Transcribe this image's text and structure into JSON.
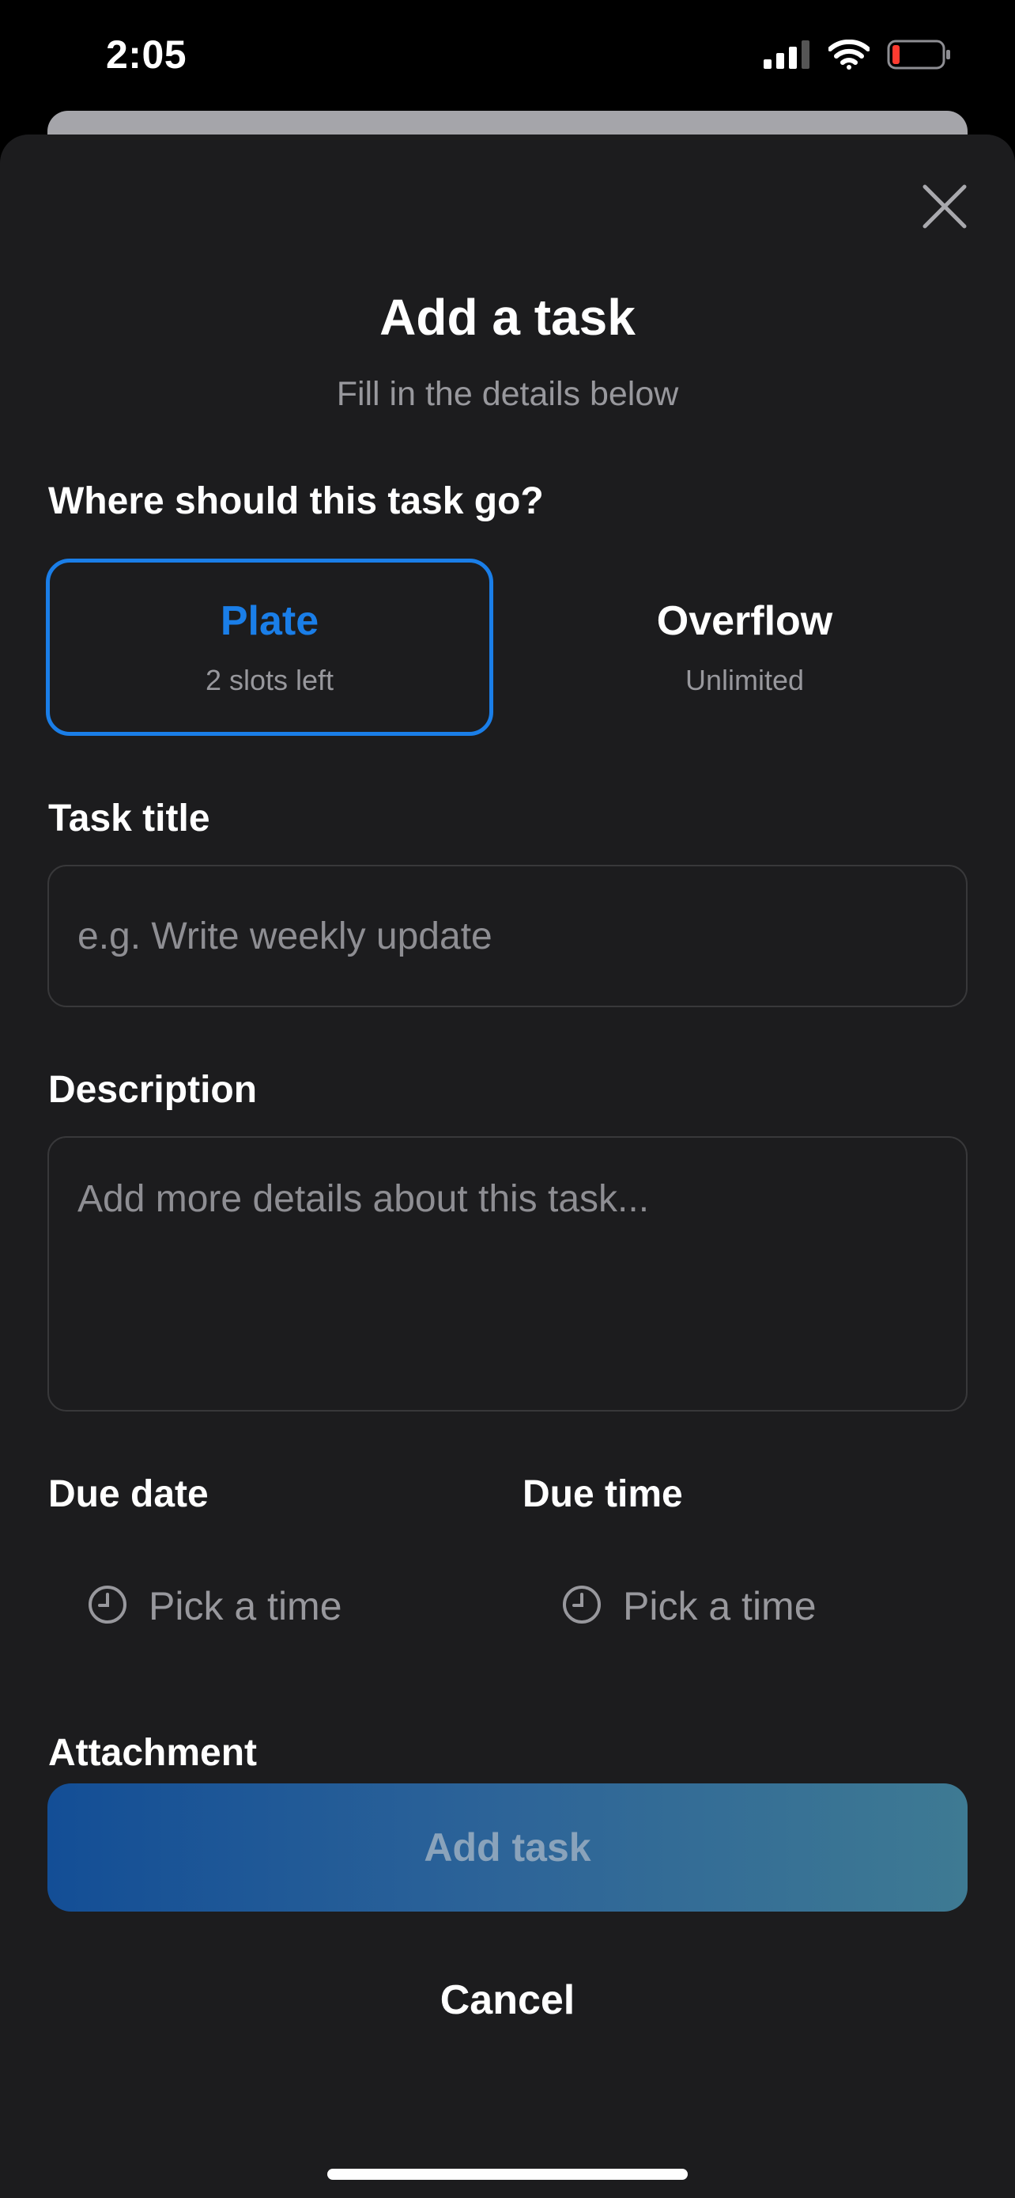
{
  "status_bar": {
    "time": "2:05",
    "icons": [
      "cellular-signal-icon",
      "wifi-icon",
      "battery-low-icon"
    ],
    "battery_color": "#ff3b30"
  },
  "sheet": {
    "close_icon": "close-icon",
    "title": "Add a task",
    "subtitle": "Fill in the details below"
  },
  "destination": {
    "label": "Where should this task go?",
    "options": [
      {
        "title": "Plate",
        "subtitle": "2 slots left",
        "selected": true
      },
      {
        "title": "Overflow",
        "subtitle": "Unlimited",
        "selected": false
      }
    ],
    "accent_color": "#1a7ee8"
  },
  "task_title": {
    "label": "Task title",
    "value": "",
    "placeholder": "e.g. Write weekly update"
  },
  "description": {
    "label": "Description",
    "value": "",
    "placeholder": "Add more details about this task..."
  },
  "due_date": {
    "label": "Due date",
    "picker_text": "Pick a time",
    "icon": "clock-icon"
  },
  "due_time": {
    "label": "Due time",
    "picker_text": "Pick a time",
    "icon": "clock-icon"
  },
  "attachment": {
    "label": "Attachment"
  },
  "actions": {
    "add_label": "Add task",
    "cancel_label": "Cancel"
  }
}
